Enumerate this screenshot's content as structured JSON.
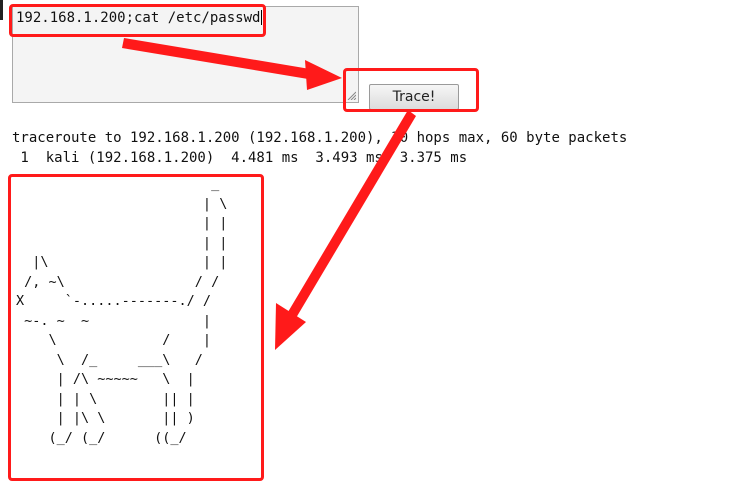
{
  "form": {
    "command_value": "192.168.1.200;cat /etc/passwd",
    "trace_button_label": "Trace!"
  },
  "output": {
    "header_line": "traceroute to 192.168.1.200 (192.168.1.200), 30 hops max, 60 byte packets",
    "hop_line": " 1  kali (192.168.1.200)  4.481 ms  3.493 ms  3.375 ms"
  },
  "ascii_art": {
    "text": "                        _\n                       | \\\n                       | |\n                       | |\n  |\\                   | |\n /, ~\\                / /\nX     `-.....-------./ /\n ~-. ~  ~              |\n    \\             /    |\n     \\  /_     ___\\   /\n     | /\\ ~~~~~   \\  |\n     | | \\        || |\n     | |\\ \\       || )\n    (_/ (_/      ((_/"
  },
  "annotations": {
    "highlight_color": "#ff1a1a"
  }
}
